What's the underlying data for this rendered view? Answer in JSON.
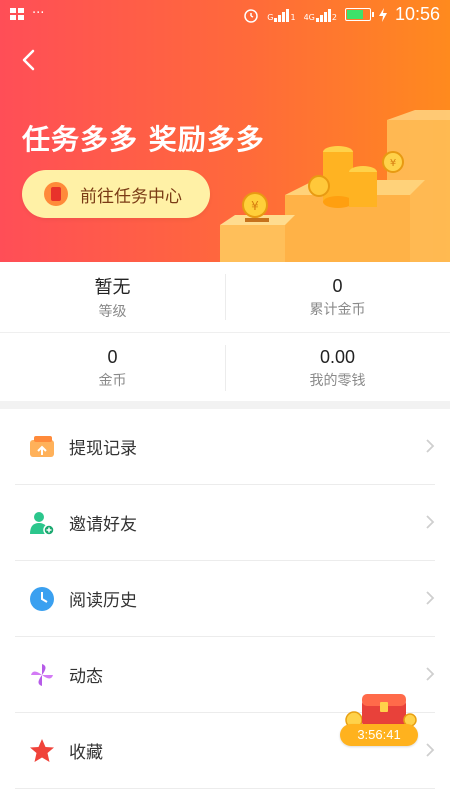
{
  "status_bar": {
    "time": "10:56",
    "network": "4G",
    "sim1": "1",
    "sim2": "2"
  },
  "hero": {
    "title": "任务多多 奖励多多",
    "task_button_label": "前往任务中心"
  },
  "stats": [
    {
      "value": "暂无",
      "label": "等级"
    },
    {
      "value": "0",
      "label": "累计金币"
    },
    {
      "value": "0",
      "label": "金币"
    },
    {
      "value": "0.00",
      "label": "我的零钱"
    }
  ],
  "menu": [
    {
      "label": "提现记录",
      "icon": "wallet-icon",
      "color": "#ff9a3a"
    },
    {
      "label": "邀请好友",
      "icon": "add-friend-icon",
      "color": "#27c48a"
    },
    {
      "label": "阅读历史",
      "icon": "clock-icon",
      "color": "#3aa0f0"
    },
    {
      "label": "动态",
      "icon": "pinwheel-icon",
      "color": "#b65be8"
    },
    {
      "label": "收藏",
      "icon": "star-icon",
      "color": "#f0433a"
    }
  ],
  "treasure": {
    "timer": "3:56:41"
  },
  "colors": {
    "hero_start": "#ff4e57",
    "hero_end": "#ff8a1e",
    "button_bg": "#fff1a6"
  }
}
